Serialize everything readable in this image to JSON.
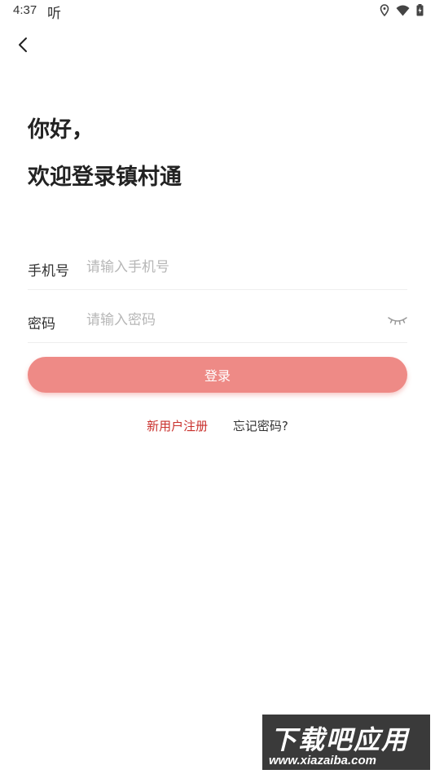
{
  "status_bar": {
    "time": "4:37",
    "app_indicator": "听",
    "icons": [
      "location-icon",
      "wifi-icon",
      "battery-charging-icon"
    ]
  },
  "nav": {
    "back_icon": "chevron-left-icon"
  },
  "header": {
    "greeting": "你好，",
    "welcome": "欢迎登录镇村通"
  },
  "form": {
    "phone_label": "手机号",
    "phone_placeholder": "请输入手机号",
    "phone_value": "",
    "password_label": "密码",
    "password_placeholder": "请输入密码",
    "password_value": "",
    "password_toggle_icon": "eye-closed-icon",
    "login_label": "登录"
  },
  "links": {
    "register": "新用户注册",
    "forgot": "忘记密码?"
  },
  "watermark": {
    "title": "下载吧应用",
    "url": "www.xiazaiba.com"
  },
  "colors": {
    "accent": "#ee8a86",
    "register_link": "#c9302c"
  }
}
